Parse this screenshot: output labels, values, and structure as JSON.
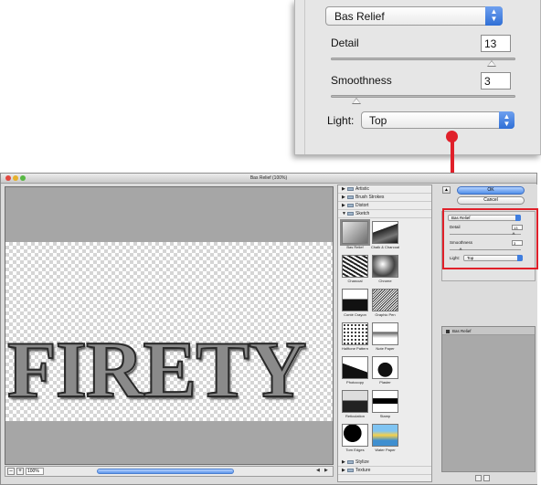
{
  "callout": {
    "filter_name": "Bas Relief",
    "detail_label": "Detail",
    "detail_value": "13",
    "detail_slider_fraction": 0.86,
    "smoothness_label": "Smoothness",
    "smoothness_value": "3",
    "smoothness_slider_fraction": 0.13,
    "light_label": "Light:",
    "light_value": "Top"
  },
  "window": {
    "title": "Bas Relief (100%)",
    "preview_text": "FIRETY",
    "zoom_minus": "–",
    "zoom_plus": "+",
    "zoom_value": "100%"
  },
  "gallery": {
    "categories_top": [
      "Artistic",
      "Brush Strokes",
      "Distort",
      "Sketch"
    ],
    "sketch_filters": [
      "Bas Relief",
      "Chalk & Charcoal",
      "Charcoal",
      "Chrome",
      "Conté Crayon",
      "Graphic Pen",
      "Halftone Pattern",
      "Note Paper",
      "Photocopy",
      "Plaster",
      "Reticulation",
      "Stamp",
      "Torn Edges",
      "Water Paper"
    ],
    "categories_bottom": [
      "Stylize",
      "Texture"
    ],
    "selected_filter": "Bas Relief"
  },
  "right_panel": {
    "ok_label": "OK",
    "cancel_label": "Cancel",
    "filter_select": "Bas Relief",
    "detail_label": "Detail",
    "detail_value": "13",
    "smoothness_label": "Smoothness",
    "smoothness_value": "3",
    "light_label": "Light:",
    "light_value": "Top",
    "layer_name": "Bas Relief"
  },
  "colors": {
    "highlight": "#e0202a",
    "accent_blue": "#4f8ee8"
  }
}
